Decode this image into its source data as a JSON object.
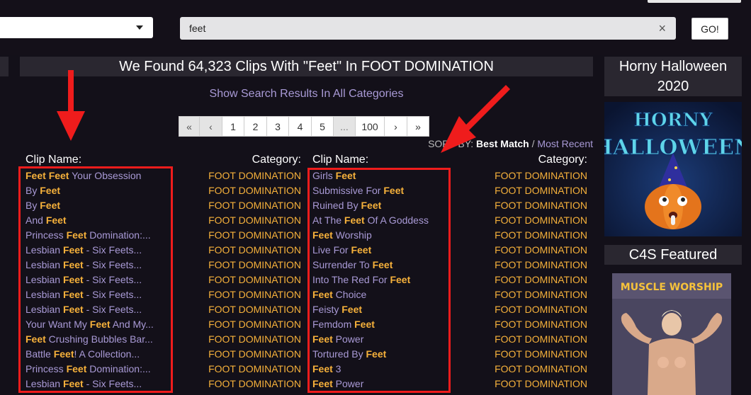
{
  "search": {
    "value": "feet",
    "clear_glyph": "×",
    "go_label": "GO!"
  },
  "results": {
    "heading": "We Found 64,323 Clips With \"Feet\" In FOOT DOMINATION",
    "all_categories_link": "Show Search Results In All Categories"
  },
  "pagination": [
    {
      "label": "«",
      "w": 30,
      "state": "disabled"
    },
    {
      "label": "‹",
      "w": 33,
      "state": "disabled"
    },
    {
      "label": "1",
      "w": 32,
      "state": "current"
    },
    {
      "label": "2",
      "w": 33,
      "state": "normal"
    },
    {
      "label": "3",
      "w": 32,
      "state": "normal"
    },
    {
      "label": "4",
      "w": 33,
      "state": "normal"
    },
    {
      "label": "5",
      "w": 32,
      "state": "normal"
    },
    {
      "label": "...",
      "w": 32,
      "state": "ellipsis"
    },
    {
      "label": "100",
      "w": 42,
      "state": "normal"
    },
    {
      "label": "›",
      "w": 33,
      "state": "normal"
    },
    {
      "label": "»",
      "w": 32,
      "state": "normal"
    }
  ],
  "sort": {
    "label": "SORT BY: ",
    "best": "Best Match",
    "sep": " / ",
    "recent": "Most Recent"
  },
  "columns": {
    "clip_header": "Clip Name:",
    "category_header": "Category:"
  },
  "left_rows": [
    {
      "parts": [
        [
          "Feet",
          true
        ],
        [
          " ",
          false
        ],
        [
          "Feet",
          true
        ],
        [
          " Your Obsession",
          false
        ]
      ],
      "category": "FOOT DOMINATION"
    },
    {
      "parts": [
        [
          "By ",
          false
        ],
        [
          "Feet",
          true
        ]
      ],
      "category": "FOOT DOMINATION"
    },
    {
      "parts": [
        [
          "By ",
          false
        ],
        [
          "Feet",
          true
        ]
      ],
      "category": "FOOT DOMINATION"
    },
    {
      "parts": [
        [
          "And ",
          false
        ],
        [
          "Feet",
          true
        ]
      ],
      "category": "FOOT DOMINATION"
    },
    {
      "parts": [
        [
          "Princess ",
          false
        ],
        [
          "Feet",
          true
        ],
        [
          " Domination:...",
          false
        ]
      ],
      "category": "FOOT DOMINATION"
    },
    {
      "parts": [
        [
          "Lesbian ",
          false
        ],
        [
          "Feet",
          true
        ],
        [
          " - Six Feets...",
          false
        ]
      ],
      "category": "FOOT DOMINATION"
    },
    {
      "parts": [
        [
          "Lesbian ",
          false
        ],
        [
          "Feet",
          true
        ],
        [
          " - Six Feets...",
          false
        ]
      ],
      "category": "FOOT DOMINATION"
    },
    {
      "parts": [
        [
          "Lesbian ",
          false
        ],
        [
          "Feet",
          true
        ],
        [
          " - Six Feets...",
          false
        ]
      ],
      "category": "FOOT DOMINATION"
    },
    {
      "parts": [
        [
          "Lesbian ",
          false
        ],
        [
          "Feet",
          true
        ],
        [
          " - Six Feets...",
          false
        ]
      ],
      "category": "FOOT DOMINATION"
    },
    {
      "parts": [
        [
          "Lesbian ",
          false
        ],
        [
          "Feet",
          true
        ],
        [
          " - Six Feets...",
          false
        ]
      ],
      "category": "FOOT DOMINATION"
    },
    {
      "parts": [
        [
          "Your Want My ",
          false
        ],
        [
          "Feet",
          true
        ],
        [
          " And My...",
          false
        ]
      ],
      "category": "FOOT DOMINATION"
    },
    {
      "parts": [
        [
          "Feet",
          true
        ],
        [
          " Crushing Bubbles Bar...",
          false
        ]
      ],
      "category": "FOOT DOMINATION"
    },
    {
      "parts": [
        [
          "Battle ",
          false
        ],
        [
          "Feet",
          true
        ],
        [
          "! A Collection...",
          false
        ]
      ],
      "category": "FOOT DOMINATION"
    },
    {
      "parts": [
        [
          "Princess ",
          false
        ],
        [
          "Feet",
          true
        ],
        [
          " Domination:...",
          false
        ]
      ],
      "category": "FOOT DOMINATION"
    },
    {
      "parts": [
        [
          "Lesbian ",
          false
        ],
        [
          "Feet",
          true
        ],
        [
          " - Six Feets...",
          false
        ]
      ],
      "category": "FOOT DOMINATION"
    }
  ],
  "right_rows": [
    {
      "parts": [
        [
          "Girls ",
          false
        ],
        [
          "Feet",
          true
        ]
      ],
      "category": "FOOT DOMINATION"
    },
    {
      "parts": [
        [
          "Submissive For ",
          false
        ],
        [
          "Feet",
          true
        ]
      ],
      "category": "FOOT DOMINATION"
    },
    {
      "parts": [
        [
          "Ruined By ",
          false
        ],
        [
          "Feet",
          true
        ]
      ],
      "category": "FOOT DOMINATION"
    },
    {
      "parts": [
        [
          "At The ",
          false
        ],
        [
          "Feet",
          true
        ],
        [
          " Of A Goddess",
          false
        ]
      ],
      "category": "FOOT DOMINATION"
    },
    {
      "parts": [
        [
          "Feet",
          true
        ],
        [
          " Worship",
          false
        ]
      ],
      "category": "FOOT DOMINATION"
    },
    {
      "parts": [
        [
          "Live For ",
          false
        ],
        [
          "Feet",
          true
        ]
      ],
      "category": "FOOT DOMINATION"
    },
    {
      "parts": [
        [
          "Surrender To ",
          false
        ],
        [
          "Feet",
          true
        ]
      ],
      "category": "FOOT DOMINATION"
    },
    {
      "parts": [
        [
          "Into The Red For ",
          false
        ],
        [
          "Feet",
          true
        ]
      ],
      "category": "FOOT DOMINATION"
    },
    {
      "parts": [
        [
          "Feet",
          true
        ],
        [
          " Choice",
          false
        ]
      ],
      "category": "FOOT DOMINATION"
    },
    {
      "parts": [
        [
          "Feisty ",
          false
        ],
        [
          "Feet",
          true
        ]
      ],
      "category": "FOOT DOMINATION"
    },
    {
      "parts": [
        [
          "Femdom ",
          false
        ],
        [
          "Feet",
          true
        ]
      ],
      "category": "FOOT DOMINATION"
    },
    {
      "parts": [
        [
          "Feet",
          true
        ],
        [
          " Power",
          false
        ]
      ],
      "category": "FOOT DOMINATION"
    },
    {
      "parts": [
        [
          "Tortured By ",
          false
        ],
        [
          "Feet",
          true
        ]
      ],
      "category": "FOOT DOMINATION"
    },
    {
      "parts": [
        [
          "Feet",
          true
        ],
        [
          " 3",
          false
        ]
      ],
      "category": "FOOT DOMINATION"
    },
    {
      "parts": [
        [
          "Feet",
          true
        ],
        [
          " Power",
          false
        ]
      ],
      "category": "FOOT DOMINATION"
    }
  ],
  "sidebar": {
    "halloween_title": "Horny Halloween 2020",
    "halloween_banner_line1": "HORNY",
    "halloween_banner_line2": "HALLOWEEN",
    "featured_title": "C4S Featured",
    "featured_banner": "MUSCLE WORSHIP"
  },
  "colors": {
    "background": "#131019",
    "panel": "#2a2730",
    "link": "#a99ad6",
    "highlight": "#f6b13b",
    "annotation": "#ef1c1c"
  }
}
